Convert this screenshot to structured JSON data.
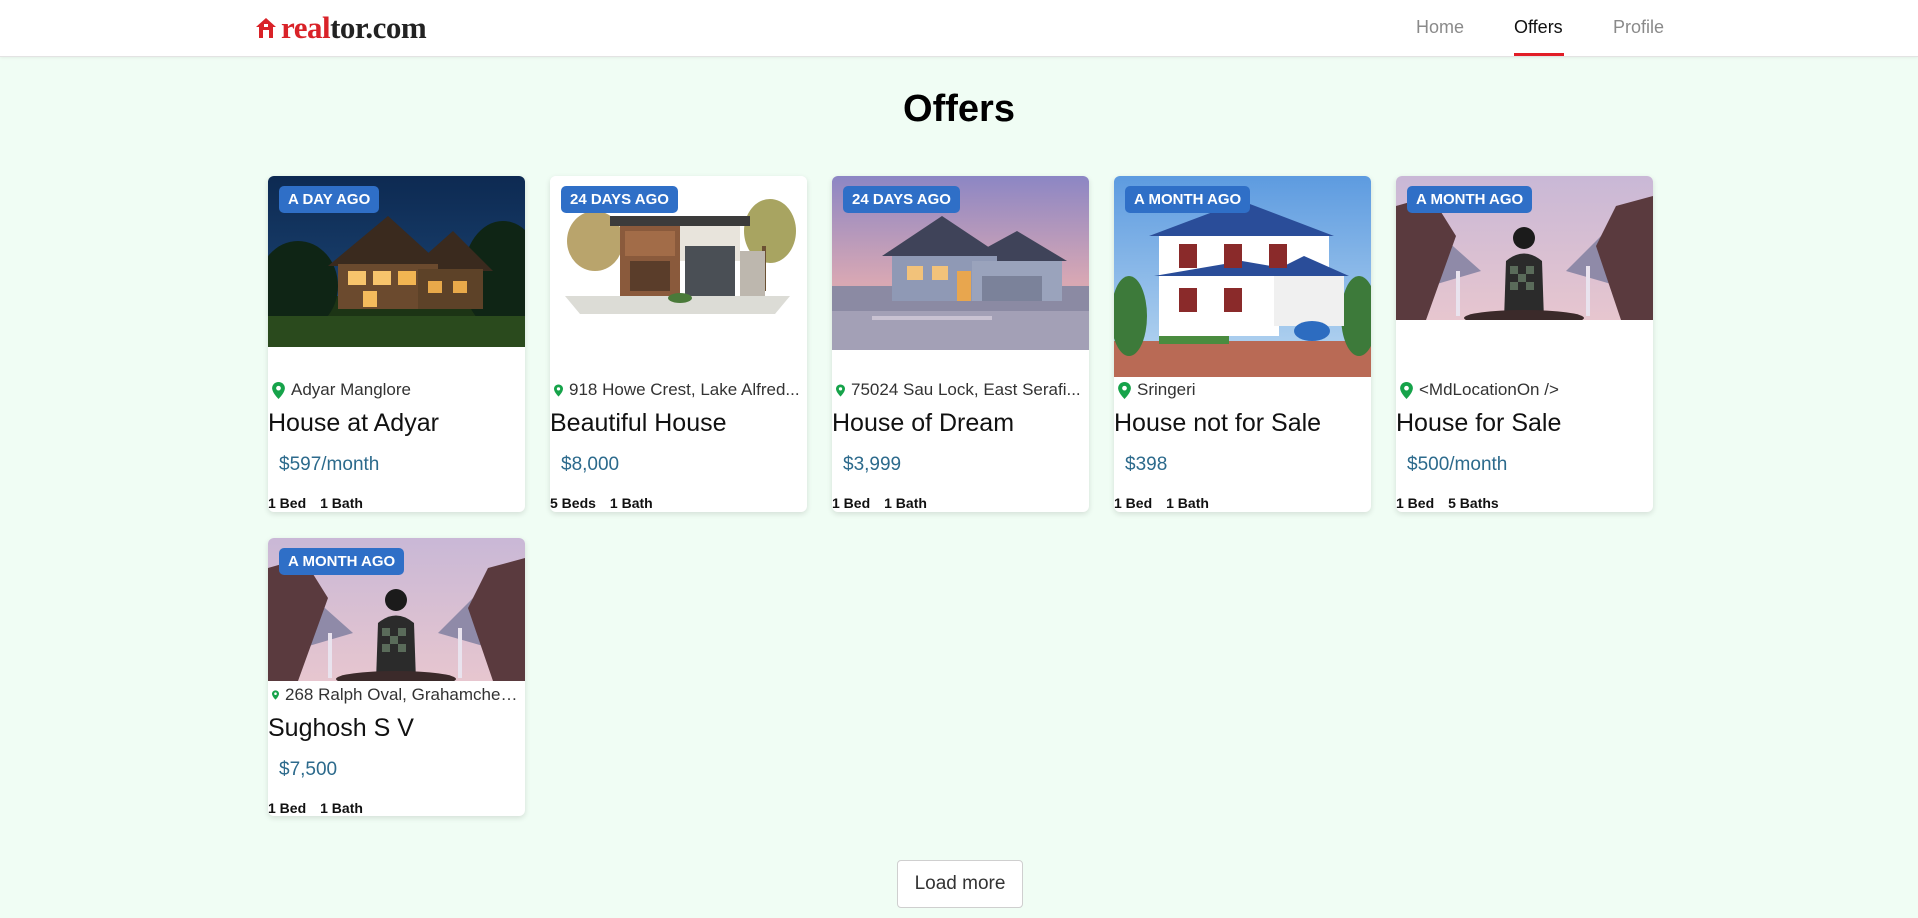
{
  "header": {
    "logo": {
      "part1": "real",
      "part2": "tor.com"
    },
    "nav": [
      {
        "label": "Home",
        "active": false
      },
      {
        "label": "Offers",
        "active": true
      },
      {
        "label": "Profile",
        "active": false
      }
    ]
  },
  "page": {
    "title": "Offers"
  },
  "cards": [
    {
      "badge": "A DAY AGO",
      "location": "Adyar Manglore",
      "title": "House at Adyar",
      "price": "$597/month",
      "beds": "1 Bed",
      "baths": "1 Bath",
      "image": "night-cabin"
    },
    {
      "badge": "24 DAYS AGO",
      "location": "918 Howe Crest, Lake Alfred...",
      "title": "Beautiful House",
      "price": "$8,000",
      "beds": "5 Beds",
      "baths": "1 Bath",
      "image": "modern-house"
    },
    {
      "badge": "24 DAYS AGO",
      "location": "75024 Sau Lock, East Serafi...",
      "title": "House of Dream",
      "price": "$3,999",
      "beds": "1 Bed",
      "baths": "1 Bath",
      "image": "suburban-house"
    },
    {
      "badge": "A MONTH AGO",
      "location": "Sringeri",
      "title": "House not for Sale",
      "price": "$398",
      "beds": "1 Bed",
      "baths": "1 Bath",
      "image": "villa"
    },
    {
      "badge": "A MONTH AGO",
      "location": "<MdLocationOn />",
      "title": "House for Sale",
      "price": "$500/month",
      "beds": "1 Bed",
      "baths": "5 Baths",
      "image": "anime-landscape"
    },
    {
      "badge": "A MONTH AGO",
      "location": "268 Ralph Oval, Grahamches...",
      "title": "Sughosh S V",
      "price": "$7,500",
      "beds": "1 Bed",
      "baths": "1 Bath",
      "image": "anime-landscape"
    }
  ],
  "load_more": {
    "label": "Load more"
  },
  "colors": {
    "background": "#f0fdf4",
    "accent": "#e11d26",
    "badge": "#2f6fc7",
    "price": "#2c6a8c",
    "pin": "#16a34a"
  }
}
